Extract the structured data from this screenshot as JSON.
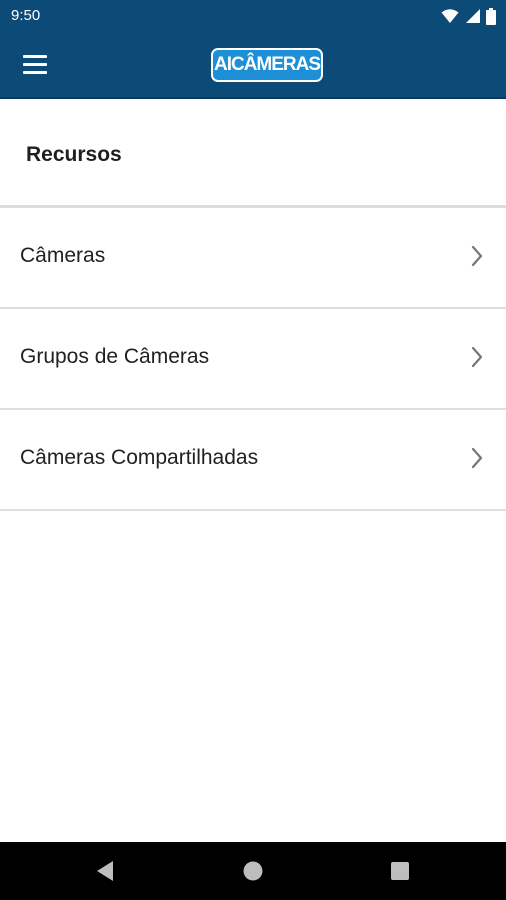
{
  "status_bar": {
    "time": "9:50",
    "icons": [
      "wifi-icon",
      "cell-signal-icon",
      "battery-icon"
    ]
  },
  "app_bar": {
    "menu_icon": "hamburger-menu-icon",
    "logo_text": "AICÂMERAS",
    "background_color": "#0c4a78",
    "logo_color": "#1c8fd6"
  },
  "section": {
    "title": "Recursos"
  },
  "list": {
    "items": [
      {
        "label": "Câmeras",
        "icon": "chevron-right-icon"
      },
      {
        "label": "Grupos de Câmeras",
        "icon": "chevron-right-icon"
      },
      {
        "label": "Câmeras Compartilhadas",
        "icon": "chevron-right-icon"
      }
    ]
  },
  "nav_bar": {
    "buttons": [
      "back-icon",
      "home-icon",
      "recents-icon"
    ]
  }
}
